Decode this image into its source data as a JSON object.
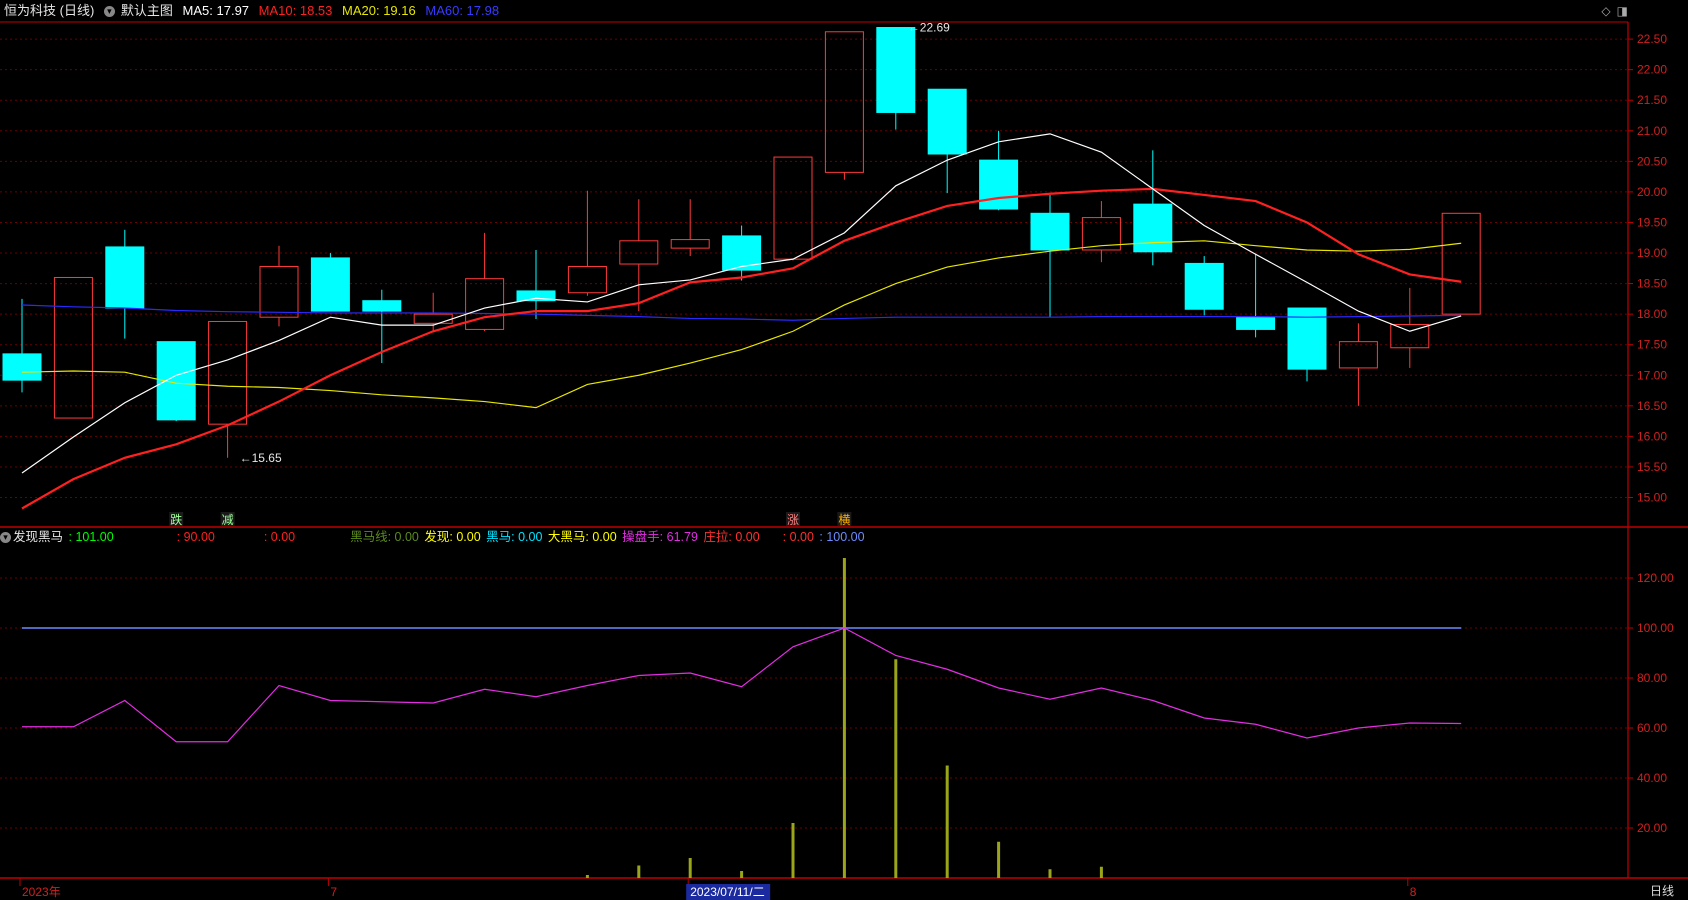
{
  "header": {
    "title": "恒为科技 (日线)",
    "main_chart_label": "默认主图",
    "ma5": "MA5: 17.97",
    "ma10": "MA10: 18.53",
    "ma20": "MA20: 19.16",
    "ma60": "MA60: 17.98"
  },
  "indicator": {
    "name": "发现黑马",
    "v1": ": 101.00",
    "v2": ": 90.00",
    "v3": ": 0.00",
    "heima_line": "黑马线: 0.00",
    "faxian": "发现: 0.00",
    "heima": "黑马: 0.00",
    "da_heima": "大黑马: 0.00",
    "caopanshou": "操盘手: 61.79",
    "zhuangla": "庄拉: 0.00",
    "v4": ": 0.00",
    "v5": ": 100.00"
  },
  "footer": {
    "right_label": "日线"
  },
  "colors": {
    "bg": "#000000",
    "up": "#ff3b3b",
    "down": "#00ffff",
    "ma5": "#ffffff",
    "ma10": "#ff2020",
    "ma20": "#e6e600",
    "ma60": "#2a2aff",
    "grid": "#6a0000",
    "axis": "#c00000",
    "baseline100": "#6b8cff",
    "caopanshou": "#e22ee2",
    "bars": "#9aa51a"
  },
  "chart_data": {
    "type": "candlestick",
    "price_axis": {
      "min": 14.55,
      "max": 22.78,
      "ticks": [
        15.0,
        15.5,
        16.0,
        16.5,
        17.0,
        17.5,
        18.0,
        18.5,
        19.0,
        19.5,
        20.0,
        20.5,
        21.0,
        21.5,
        22.0,
        22.5
      ]
    },
    "candles": [
      {
        "o": 17.35,
        "h": 18.25,
        "l": 16.72,
        "c": 16.92
      },
      {
        "o": 16.3,
        "h": 18.6,
        "l": 16.3,
        "c": 18.6
      },
      {
        "o": 19.1,
        "h": 19.38,
        "l": 17.6,
        "c": 18.1
      },
      {
        "o": 17.55,
        "h": 17.55,
        "l": 16.25,
        "c": 16.27
      },
      {
        "o": 16.2,
        "h": 17.88,
        "l": 15.65,
        "c": 17.88
      },
      {
        "o": 17.95,
        "h": 19.12,
        "l": 17.8,
        "c": 18.78
      },
      {
        "o": 18.92,
        "h": 19.0,
        "l": 18.05,
        "c": 18.05
      },
      {
        "o": 18.22,
        "h": 18.4,
        "l": 17.2,
        "c": 18.05
      },
      {
        "o": 17.85,
        "h": 18.35,
        "l": 17.7,
        "c": 18.0
      },
      {
        "o": 17.75,
        "h": 19.33,
        "l": 17.72,
        "c": 18.58
      },
      {
        "o": 18.38,
        "h": 19.05,
        "l": 17.92,
        "c": 18.22
      },
      {
        "o": 18.35,
        "h": 20.02,
        "l": 18.3,
        "c": 18.78
      },
      {
        "o": 18.82,
        "h": 19.88,
        "l": 18.05,
        "c": 19.2
      },
      {
        "o": 19.08,
        "h": 19.88,
        "l": 18.95,
        "c": 19.22
      },
      {
        "o": 19.28,
        "h": 19.45,
        "l": 18.55,
        "c": 18.72
      },
      {
        "o": 18.9,
        "h": 20.57,
        "l": 18.88,
        "c": 20.57
      },
      {
        "o": 20.32,
        "h": 22.62,
        "l": 20.2,
        "c": 22.62
      },
      {
        "o": 22.69,
        "h": 22.69,
        "l": 21.02,
        "c": 21.3
      },
      {
        "o": 21.68,
        "h": 21.68,
        "l": 19.98,
        "c": 20.62
      },
      {
        "o": 20.52,
        "h": 21.0,
        "l": 19.7,
        "c": 19.72
      },
      {
        "o": 19.65,
        "h": 19.95,
        "l": 17.95,
        "c": 19.05
      },
      {
        "o": 19.05,
        "h": 19.85,
        "l": 18.85,
        "c": 19.58
      },
      {
        "o": 19.8,
        "h": 20.68,
        "l": 18.8,
        "c": 19.02
      },
      {
        "o": 18.83,
        "h": 18.95,
        "l": 17.98,
        "c": 18.08
      },
      {
        "o": 17.95,
        "h": 18.98,
        "l": 17.62,
        "c": 17.75
      },
      {
        "o": 18.1,
        "h": 18.1,
        "l": 16.9,
        "c": 17.1
      },
      {
        "o": 17.12,
        "h": 17.85,
        "l": 16.5,
        "c": 17.55
      },
      {
        "o": 17.45,
        "h": 18.43,
        "l": 17.12,
        "c": 17.83
      },
      {
        "o": 18.0,
        "h": 19.65,
        "l": 18.0,
        "c": 19.65
      }
    ],
    "ma5": [
      15.4,
      15.99,
      16.55,
      17.0,
      17.25,
      17.57,
      17.95,
      17.82,
      17.82,
      18.1,
      18.26,
      18.2,
      18.48,
      18.56,
      18.78,
      18.9,
      19.33,
      20.1,
      20.52,
      20.82,
      20.95,
      20.65,
      20.05,
      19.45,
      18.98,
      18.52,
      18.05,
      17.72,
      17.97
    ],
    "ma10": [
      14.82,
      15.3,
      15.65,
      15.87,
      16.18,
      16.57,
      17.0,
      17.38,
      17.72,
      17.95,
      18.05,
      18.05,
      18.18,
      18.52,
      18.6,
      18.75,
      19.2,
      19.5,
      19.77,
      19.9,
      19.97,
      20.02,
      20.05,
      19.95,
      19.85,
      19.5,
      18.98,
      18.65,
      18.53
    ],
    "ma20": [
      17.05,
      17.07,
      17.05,
      16.87,
      16.82,
      16.8,
      16.75,
      16.68,
      16.63,
      16.57,
      16.47,
      16.85,
      17.0,
      17.2,
      17.42,
      17.72,
      18.15,
      18.5,
      18.77,
      18.92,
      19.03,
      19.12,
      19.17,
      19.2,
      19.12,
      19.05,
      19.03,
      19.06,
      19.16
    ],
    "ma60": [
      18.15,
      18.12,
      18.1,
      18.06,
      18.04,
      18.03,
      18.02,
      18.02,
      18.02,
      18.01,
      18.0,
      17.98,
      17.96,
      17.93,
      17.92,
      17.9,
      17.93,
      17.95,
      17.95,
      17.95,
      17.95,
      17.96,
      17.96,
      17.96,
      17.96,
      17.95,
      17.96,
      17.97,
      17.98
    ],
    "price_annotations": [
      {
        "index": 17,
        "price": 22.69,
        "text": "22.69"
      },
      {
        "index": 4,
        "price": 15.65,
        "text": "15.65"
      }
    ],
    "signals": [
      {
        "index": 3,
        "text": "跌",
        "color": "#a0ff9a"
      },
      {
        "index": 4,
        "text": "减",
        "color": "#a0ff9a"
      },
      {
        "index": 15,
        "text": "涨",
        "color": "#ff8080"
      },
      {
        "index": 16,
        "text": "横",
        "color": "#ffb000"
      }
    ],
    "indicator_axis": {
      "min": 0,
      "max": 132,
      "ticks": [
        20,
        40,
        60,
        80,
        100,
        120
      ]
    },
    "caopanshou": [
      60.5,
      60.5,
      71,
      54.5,
      54.5,
      77,
      71,
      70.5,
      70,
      75.5,
      72.5,
      77,
      81,
      82,
      76.5,
      92.5,
      100,
      89,
      83.5,
      76,
      71.5,
      76,
      71,
      64,
      61.5,
      56,
      60,
      62,
      61.79
    ],
    "heima_bars": [
      0,
      0,
      0,
      0,
      0,
      0,
      0,
      0,
      0,
      0,
      0,
      1.2,
      5,
      8,
      2.8,
      22,
      128,
      87.5,
      45,
      14.5,
      3.5,
      4.5,
      0,
      0,
      0,
      0,
      0,
      0,
      0
    ],
    "baseline": 100,
    "x_labels": [
      {
        "index": 0,
        "text": "2023年"
      },
      {
        "index": 6,
        "text": "7"
      },
      {
        "index": 13,
        "text": "2023/07/11/二"
      },
      {
        "index": 27,
        "text": "8"
      }
    ]
  }
}
